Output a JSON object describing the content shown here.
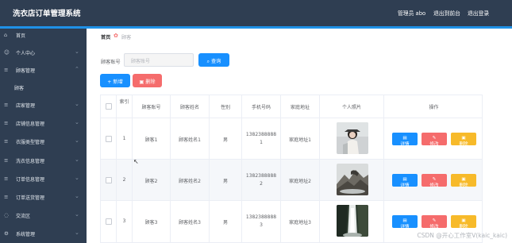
{
  "app": {
    "title": "洗衣店订单管理系统"
  },
  "header": {
    "user": "管理员 abo",
    "back_to_frontend": "退出到前台",
    "logout": "退出登录"
  },
  "sidebar": {
    "items": [
      {
        "label": "首页",
        "icon": "home-icon",
        "has_chevron": false
      },
      {
        "label": "个人中心",
        "icon": "user-icon",
        "has_chevron": true
      },
      {
        "label": "顾客管理",
        "icon": "list-icon",
        "has_chevron": true
      },
      {
        "label": "顾客",
        "icon": "",
        "has_chevron": false,
        "sub": true
      },
      {
        "label": "店家管理",
        "icon": "list-icon",
        "has_chevron": true
      },
      {
        "label": "店铺信息管理",
        "icon": "list-icon",
        "has_chevron": true
      },
      {
        "label": "衣服类型管理",
        "icon": "list-icon",
        "has_chevron": true
      },
      {
        "label": "洗衣信息管理",
        "icon": "list-icon",
        "has_chevron": true
      },
      {
        "label": "订单信息管理",
        "icon": "list-icon",
        "has_chevron": true
      },
      {
        "label": "订单送货管理",
        "icon": "list-icon",
        "has_chevron": true
      },
      {
        "label": "交流区",
        "icon": "chat-icon",
        "has_chevron": true
      },
      {
        "label": "系统管理",
        "icon": "gear-icon",
        "has_chevron": true
      }
    ]
  },
  "breadcrumb": {
    "home": "首页",
    "current": "顾客"
  },
  "search": {
    "label": "顾客账号",
    "placeholder": "顾客账号",
    "button": "查询"
  },
  "toolbar": {
    "add": "新增",
    "delete": "删除"
  },
  "table": {
    "headers": [
      "",
      "索引",
      "顾客账号",
      "顾客姓名",
      "性别",
      "手机号码",
      "家庭地址",
      "个人照片",
      "操作"
    ],
    "rows": [
      {
        "index": "1",
        "account": "顾客1",
        "name": "顾客姓名1",
        "gender": "男",
        "phone_line1": "1382388888",
        "phone_line2": "1",
        "address": "家庭地址1",
        "photo": "woman-portrait"
      },
      {
        "index": "2",
        "account": "顾客2",
        "name": "顾客姓名2",
        "gender": "男",
        "phone_line1": "1382388888",
        "phone_line2": "2",
        "address": "家庭地址2",
        "photo": "mountain-landscape"
      },
      {
        "index": "3",
        "account": "顾客3",
        "name": "顾客姓名3",
        "gender": "男",
        "phone_line1": "1382388888",
        "phone_line2": "3",
        "address": "家庭地址3",
        "photo": "waterfall-landscape"
      }
    ],
    "actions": {
      "detail": "详情",
      "edit": "修改",
      "delete": "删除"
    }
  },
  "watermark": "CSDN @开心工作室V(kaic_kaic)",
  "colors": {
    "topbar": "#2f3e52",
    "sidebar": "#2f3e52",
    "accent": "#1f91e6",
    "primary": "#1890ff",
    "danger": "#f56c6c",
    "warning": "#f7ba2a",
    "row_stripe": "#f5f7fa"
  }
}
